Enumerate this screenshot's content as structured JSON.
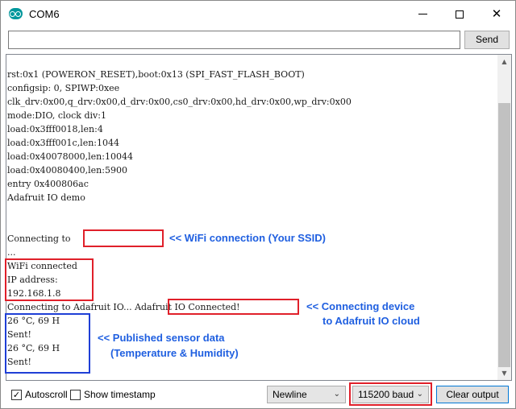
{
  "window": {
    "title": "COM6"
  },
  "send": {
    "input_value": "",
    "button_label": "Send"
  },
  "output": {
    "lines": [
      "rst:0x1 (POWERON_RESET),boot:0x13 (SPI_FAST_FLASH_BOOT)",
      "configsip: 0, SPIWP:0xee",
      "clk_drv:0x00,q_drv:0x00,d_drv:0x00,cs0_drv:0x00,hd_drv:0x00,wp_drv:0x00",
      "mode:DIO, clock div:1",
      "load:0x3fff0018,len:4",
      "load:0x3fff001c,len:1044",
      "load:0x40078000,len:10044",
      "load:0x40080400,len:5900",
      "entry 0x400806ac",
      "Adafruit IO demo",
      "",
      "",
      "Connecting to",
      "...",
      "WiFi connected",
      "IP address:",
      "192.168.1.8",
      "Connecting to Adafruit IO... Adafruit IO Connected!",
      "26 °C, 69 H",
      "Sent!",
      "26 °C, 69 H",
      "Sent!"
    ]
  },
  "annotations": {
    "wifi": "<< WiFi connection (Your SSID)",
    "adafruit_line1": "<< Connecting device",
    "adafruit_line2": "to Adafruit IO cloud",
    "sensor_line1": "<< Published sensor data",
    "sensor_line2": "(Temperature & Humidity)",
    "colors": {
      "box_red": "#e0202a",
      "box_blue": "#1f3fd6",
      "text_blue": "#1f5fe0"
    }
  },
  "bottom": {
    "autoscroll_label": "Autoscroll",
    "autoscroll_checked": "✓",
    "timestamp_label": "Show timestamp",
    "line_ending": "Newline",
    "baud": "115200 baud",
    "clear_label": "Clear output"
  },
  "icons": {
    "app": "arduino-icon",
    "minimize": "minimize-icon",
    "maximize": "maximize-icon",
    "close": "close-icon",
    "chevron": "chevron-down-icon"
  }
}
